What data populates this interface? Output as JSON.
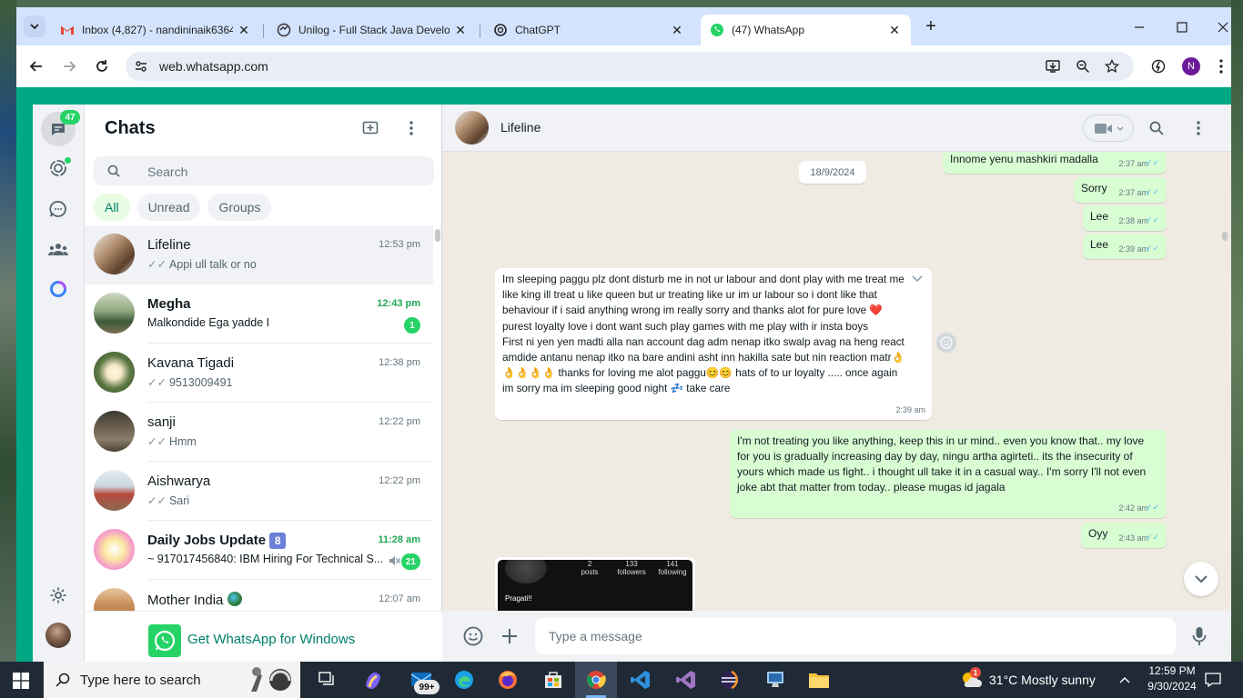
{
  "browser": {
    "tabs": [
      {
        "title": "Inbox (4,827) - nandininaik6364",
        "icon": "gmail-icon"
      },
      {
        "title": "Unilog - Full Stack Java Develop",
        "icon": "unilog-icon"
      },
      {
        "title": "ChatGPT",
        "icon": "chatgpt-icon"
      },
      {
        "title": "(47) WhatsApp",
        "icon": "whatsapp-icon"
      }
    ],
    "close_glyph": "✕",
    "new_tab_glyph": "+",
    "url": "web.whatsapp.com",
    "profile_initial": "N",
    "accent": "#d3e3fd"
  },
  "whatsapp": {
    "brand_color": "#00a884",
    "unread_badge": "47",
    "chats_title": "Chats",
    "search_placeholder": "Search",
    "filters": [
      "All",
      "Unread",
      "Groups"
    ],
    "chats": [
      {
        "name": "Lifeline",
        "time": "12:53 pm",
        "preview": "Appi ull talk or no",
        "ticks": "✓✓",
        "selected": true
      },
      {
        "name": "Megha",
        "time": "12:43 pm",
        "preview": "Malkondide Ega yadde I",
        "unread": "1"
      },
      {
        "name": "Kavana Tigadi",
        "time": "12:38 pm",
        "preview": "9513009491",
        "ticks": "✓✓"
      },
      {
        "name": "sanji",
        "time": "12:22 pm",
        "preview": "Hmm",
        "ticks": "✓✓"
      },
      {
        "name": "Aishwarya",
        "time": "12:22 pm",
        "preview": "Sari",
        "ticks": "✓✓"
      },
      {
        "name": "Daily Jobs Update",
        "name_emoji": "8",
        "time": "11:28 am",
        "preview": "~ 917017456840: IBM Hiring For Technical S...",
        "unread": "21"
      },
      {
        "name": "Mother India",
        "time": "12:07 am",
        "preview": ""
      }
    ],
    "get_app": "Get WhatsApp for Windows",
    "conversation": {
      "contact": "Lifeline",
      "date_chip": "18/9/2024",
      "messages": [
        {
          "dir": "out",
          "text": "Innome yenu mashkiri madalla",
          "time": "2:37 am"
        },
        {
          "dir": "out",
          "text": "Sorry",
          "time": "2:37 am"
        },
        {
          "dir": "out",
          "text": "Lee",
          "time": "2:38 am"
        },
        {
          "dir": "out",
          "text": "Lee",
          "time": "2:39 am"
        },
        {
          "dir": "in",
          "text": "Im sleeping paggu plz dont disturb me in not ur labour and dont play with me treat me like king ill treat u like queen but ur treating like ur im ur labour so i dont like that behaviour if i said anything wrong im really sorry and thanks alot for pure love ❤️ purest loyalty love i dont want such play games with me play with ir insta boys\nFirst ni yen yen madti alla nan account dag adm nenap itko swalp avag na heng react amdide antanu nenap itko na bare andini asht inn hakilla sate but nin reaction matr👌👌👌👌👌 thanks for loving me alot paggu😊😊 hats of to ur loyalty .....  once again im sorry ma im sleeping good night 💤 take care",
          "time": "2:39 am"
        },
        {
          "dir": "out",
          "text": "I'm not treating you like anything, keep this in ur mind.. even you know that.. my love for you is gradually increasing day by day, ningu artha agirteti.. its the insecurity of yours which made us fight.. i thought ull take it in a casual way.. I'm sorry I'll not even joke abt that matter from today.. please mugas id jagala",
          "time": "2:42 am"
        },
        {
          "dir": "out",
          "text": "Oyy",
          "time": "2:43 am"
        }
      ],
      "profile_card": {
        "posts_count": "2",
        "posts_label": "posts",
        "followers_count": "133",
        "followers_label": "followers",
        "following_count": "141",
        "following_label": "following",
        "name": "Pragati!!"
      },
      "composer_placeholder": "Type a message"
    }
  },
  "taskbar": {
    "search_placeholder": "Type here to search",
    "mail_badge": "99+",
    "weather_alert": "1",
    "weather": "31°C  Mostly sunny",
    "time": "12:59 PM",
    "date": "9/30/2024"
  }
}
